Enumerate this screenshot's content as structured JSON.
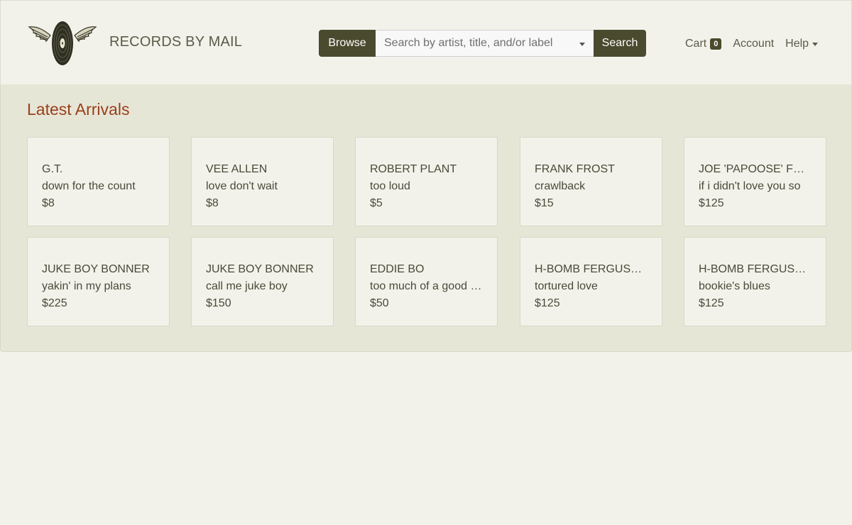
{
  "header": {
    "brand": "RECORDS BY MAIL",
    "browse_label": "Browse",
    "search_placeholder": "Search by artist, title, and/or label",
    "search_label": "Search",
    "nav": {
      "cart_label": "Cart",
      "cart_count": "0",
      "account_label": "Account",
      "help_label": "Help"
    }
  },
  "main": {
    "section_title": "Latest Arrivals",
    "items": [
      {
        "artist": "G.T.",
        "title": "down for the count",
        "price": "$8"
      },
      {
        "artist": "VEE ALLEN",
        "title": "love don't wait",
        "price": "$8"
      },
      {
        "artist": "ROBERT PLANT",
        "title": "too loud",
        "price": "$5"
      },
      {
        "artist": "FRANK FROST",
        "title": "crawlback",
        "price": "$15"
      },
      {
        "artist": "JOE 'PAPOOSE' FRITZ",
        "title": "if i didn't love you so",
        "price": "$125"
      },
      {
        "artist": "JUKE BOY BONNER",
        "title": "yakin' in my plans",
        "price": "$225"
      },
      {
        "artist": "JUKE BOY BONNER",
        "title": "call me juke boy",
        "price": "$150"
      },
      {
        "artist": "EDDIE BO",
        "title": "too much of a good thing",
        "price": "$50"
      },
      {
        "artist": "H-BOMB FERGUSON",
        "title": "tortured love",
        "price": "$125"
      },
      {
        "artist": "H-BOMB FERGUSON",
        "title": "bookie's blues",
        "price": "$125"
      }
    ]
  },
  "colors": {
    "accent": "#4a4a2e",
    "section_title": "#9a3f1a",
    "background": "#f3f2ea",
    "panel": "#e6e6d7"
  },
  "icons": {
    "logo": "winged-record-logo-icon",
    "search_caret": "chevron-down-icon",
    "help_caret": "chevron-down-icon"
  }
}
